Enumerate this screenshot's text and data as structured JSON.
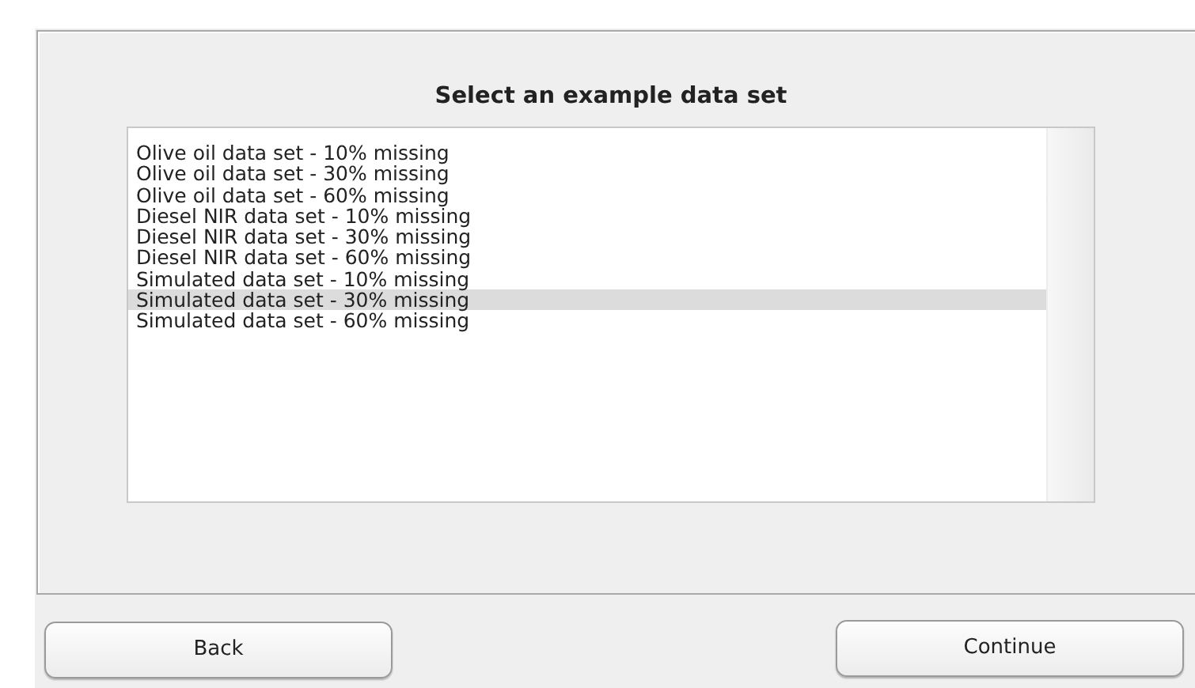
{
  "title": "Select an example data set",
  "items": [
    {
      "label": "Olive oil data set - 10% missing",
      "selected": false
    },
    {
      "label": "Olive oil data set - 30% missing",
      "selected": false
    },
    {
      "label": "Olive oil data set - 60% missing",
      "selected": false
    },
    {
      "label": "Diesel NIR data set - 10% missing",
      "selected": false
    },
    {
      "label": "Diesel NIR data set - 30% missing",
      "selected": false
    },
    {
      "label": "Diesel NIR data set - 60% missing",
      "selected": false
    },
    {
      "label": "Simulated data set - 10% missing",
      "selected": false
    },
    {
      "label": "Simulated data set - 30% missing",
      "selected": true
    },
    {
      "label": "Simulated data set - 60% missing",
      "selected": false
    }
  ],
  "buttons": [
    "Back",
    "Continue"
  ]
}
